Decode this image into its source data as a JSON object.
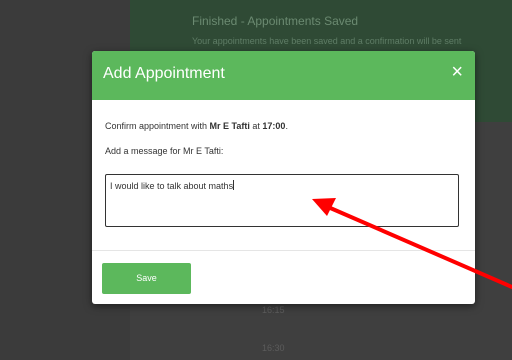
{
  "background": {
    "banner_title": "Finished - Appointments Saved",
    "banner_subtitle": "Your appointments have been saved and a confirmation will be sent",
    "slots": [
      "16:15",
      "16:30"
    ]
  },
  "modal": {
    "title": "Add Appointment",
    "close_symbol": "×",
    "confirm_prefix": "Confirm appointment with ",
    "teacher": "Mr E Tafti",
    "confirm_mid": " at ",
    "time": "17:00",
    "confirm_suffix": ".",
    "message_label": "Add a message for Mr E Tafti:",
    "message_value": "I would like to talk about maths",
    "save_label": "Save"
  },
  "colors": {
    "accent": "#5cb85c",
    "annotation_arrow": "#ff0000"
  },
  "annotation": {
    "icon": "red-arrow-icon"
  }
}
